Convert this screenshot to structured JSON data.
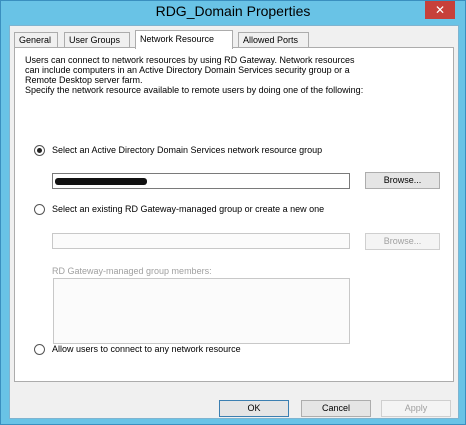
{
  "window": {
    "title": "RDG_Domain Properties",
    "close_glyph": "✕"
  },
  "tabs": [
    {
      "label": "General",
      "active": false
    },
    {
      "label": "User Groups",
      "active": false
    },
    {
      "label": "Network Resource",
      "active": true
    },
    {
      "label": "Allowed Ports",
      "active": false
    }
  ],
  "description": {
    "line1": "Users can connect to network resources by using RD Gateway. Network resources",
    "line2": "can include computers in an Active Directory Domain Services security group or a",
    "line3": "Remote Desktop server farm.",
    "line4": "Specify the network resource available to remote users by doing one of the following:"
  },
  "options": {
    "ad_group": {
      "label": "Select an Active Directory Domain Services network resource group",
      "selected": true,
      "value": "",
      "browse_label": "Browse..."
    },
    "rdg_group": {
      "label": "Select an existing RD Gateway-managed group or create a new one",
      "selected": false,
      "value": "",
      "browse_label": "Browse...",
      "members_label": "RD Gateway-managed group members:"
    },
    "any_resource": {
      "label": "Allow users to connect to any network resource",
      "selected": false
    }
  },
  "footer": {
    "ok_label": "OK",
    "cancel_label": "Cancel",
    "apply_label": "Apply"
  },
  "colors": {
    "frame": "#69c3e6",
    "close": "#c7403a",
    "face": "#f0f0f0"
  }
}
